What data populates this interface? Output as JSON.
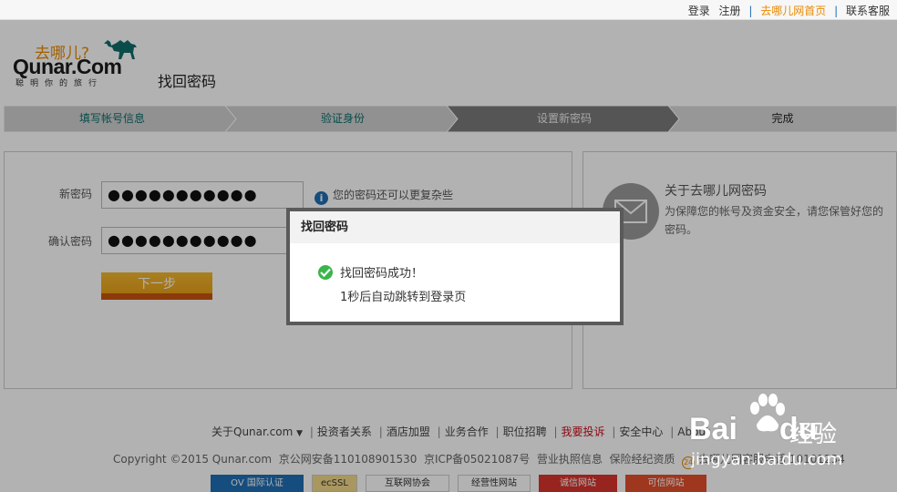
{
  "topbar": {
    "login": "登录",
    "register": "注册",
    "home": "去哪儿网首页",
    "contact": "联系客服"
  },
  "logo": {
    "cn": "去哪儿?",
    "en": "Qunar.Com",
    "slogan": "聪明你的旅行"
  },
  "page_title": "找回密码",
  "steps": [
    {
      "label": "填写帐号信息",
      "state": "done"
    },
    {
      "label": "验证身份",
      "state": "done"
    },
    {
      "label": "设置新密码",
      "state": "current"
    },
    {
      "label": "完成",
      "state": "pending"
    }
  ],
  "form": {
    "new_password_label": "新密码",
    "new_password_value": "●●●●●●●●●●●",
    "confirm_password_label": "确认密码",
    "confirm_password_value": "●●●●●●●●●●●",
    "hint": "您的密码还可以更复杂些",
    "next_button": "下一步"
  },
  "about": {
    "title": "关于去哪儿网密码",
    "description": "为保障您的帐号及资金安全，请您保管好您的密码。"
  },
  "footer": {
    "links": [
      "关于Qunar.com",
      "投资者关系",
      "酒店加盟",
      "业务合作",
      "职位招聘",
      "我要投诉",
      "安全中心",
      "About"
    ],
    "copyright": "Copyright ©2015 Qunar.com",
    "icp1": "京公网安备110108901530",
    "icp2": "京ICP备05021087号",
    "license": "营业执照信息",
    "insurance": "保险经纪资质",
    "phone": "去哪儿网客服电话 10101234",
    "badges": [
      "OV 国际认证",
      "ecSSL",
      "互联网协会",
      "经营性网站",
      "诚信网站",
      "可信网站"
    ]
  },
  "modal": {
    "title": "找回密码",
    "success": "找回密码成功！",
    "redirect": "1秒后自动跳转到登录页"
  },
  "watermark": {
    "logo": "Bai",
    "logo_tail": "du",
    "cn": "经验",
    "url": "jingyan.baidu.com"
  },
  "colors": {
    "accent_orange": "#e98a00",
    "link_blue": "#1f6fb5",
    "step_done_text": "#0a6d6d",
    "success_green": "#39b54a",
    "complaint_red": "#c8101a"
  }
}
